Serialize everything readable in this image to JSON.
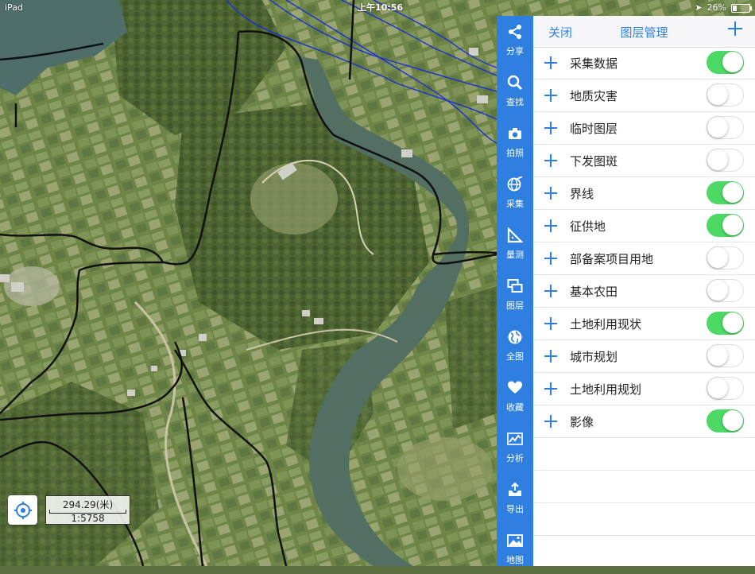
{
  "status_bar": {
    "device": "iPad",
    "time": "上午10:56",
    "battery": "26%",
    "battery_level": 0.26
  },
  "map": {
    "scale_distance": "294.29(米)",
    "scale_ratio": "1:5758"
  },
  "toolbar": {
    "items": [
      {
        "label": "分享",
        "icon": "share-icon"
      },
      {
        "label": "查找",
        "icon": "search-icon"
      },
      {
        "label": "拍照",
        "icon": "camera-icon"
      },
      {
        "label": "采集",
        "icon": "globe-pen-icon"
      },
      {
        "label": "量测",
        "icon": "ruler-triangle-icon"
      },
      {
        "label": "图层",
        "icon": "layers-icon"
      },
      {
        "label": "全图",
        "icon": "globe-icon"
      },
      {
        "label": "收藏",
        "icon": "heart-icon"
      },
      {
        "label": "分析",
        "icon": "chart-icon"
      },
      {
        "label": "导出",
        "icon": "export-icon"
      },
      {
        "label": "地图",
        "icon": "map-image-icon"
      }
    ]
  },
  "layer_panel": {
    "close_label": "关闭",
    "title": "图层管理",
    "layers": [
      {
        "name": "采集数据",
        "on": true
      },
      {
        "name": "地质灾害",
        "on": false
      },
      {
        "name": "临时图层",
        "on": false
      },
      {
        "name": "下发图斑",
        "on": false
      },
      {
        "name": "界线",
        "on": true
      },
      {
        "name": "征供地",
        "on": true
      },
      {
        "name": "部备案项目用地",
        "on": false
      },
      {
        "name": "基本农田",
        "on": false
      },
      {
        "name": "土地利用现状",
        "on": true
      },
      {
        "name": "城市规划",
        "on": false
      },
      {
        "name": "土地利用规划",
        "on": false
      },
      {
        "name": "影像",
        "on": true
      }
    ]
  },
  "colors": {
    "toolbar_blue": "#2f7fe0",
    "switch_on": "#4cd964",
    "boundary_black": "#111111",
    "road_blue": "#1a2fd6"
  }
}
